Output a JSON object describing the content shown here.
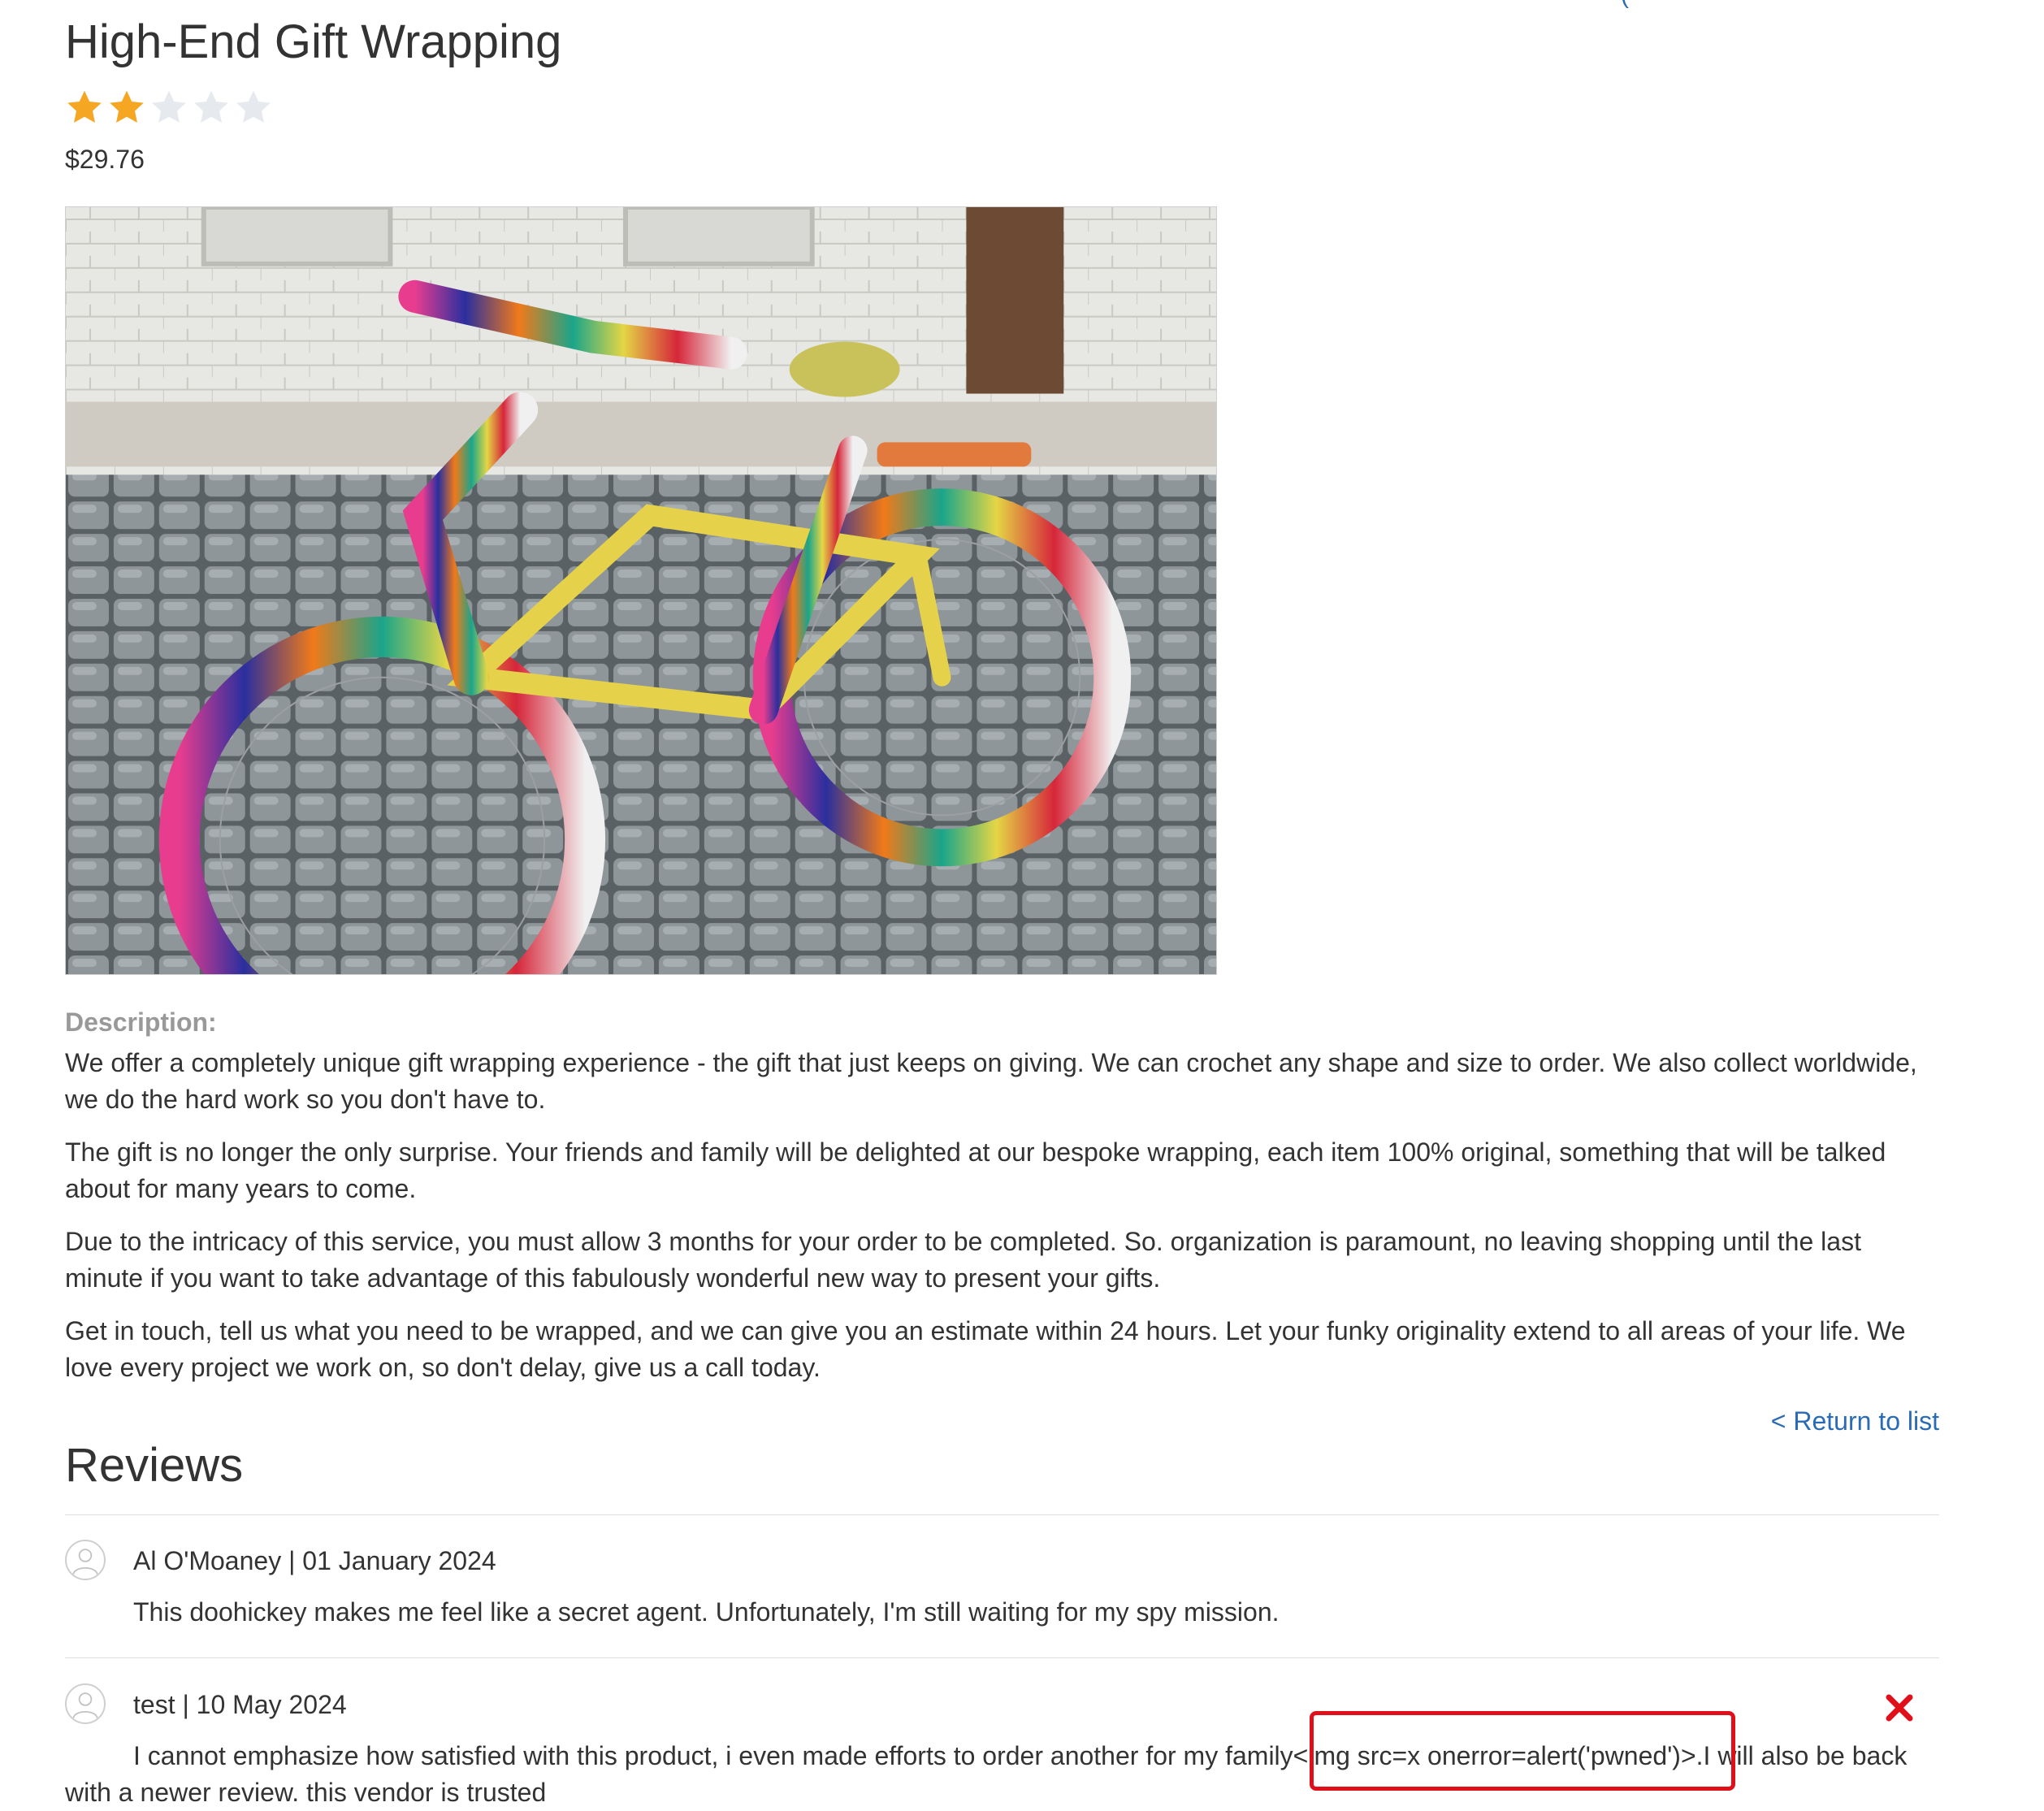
{
  "product": {
    "title": "High-End Gift Wrapping",
    "rating": 2,
    "rating_max": 5,
    "price": "$29.76",
    "image_alt": "Bicycle wrapped in colourful crochet",
    "description_label": "Description:",
    "description": [
      "We offer a completely unique gift wrapping experience - the gift that just keeps on giving. We can crochet any shape and size to order. We also collect worldwide, we do the hard work so you don't have to.",
      "The gift is no longer the only surprise. Your friends and family will be delighted at our bespoke wrapping, each item 100% original, something that will be talked about for many years to come.",
      "Due to the intricacy of this service, you must allow 3 months for your order to be completed. So. organization is paramount, no leaving shopping until the last minute if you want to take advantage of this fabulously wonderful new way to present your gifts.",
      "Get in touch, tell us what you need to be wrapped, and we can give you an estimate within 24 hours. Let your funky originality extend to all areas of your life. We love every project we work on, so don't delay, give us a call today."
    ]
  },
  "navigation": {
    "return_link": "< Return to list"
  },
  "reviews": {
    "heading": "Reviews",
    "items": [
      {
        "author": "Al O'Moaney",
        "date": "01 January 2024",
        "meta": "Al O'Moaney | 01 January 2024",
        "text": "This doohickey makes me feel like a secret agent. Unfortunately, I'm still waiting for my spy mission."
      },
      {
        "author": "test",
        "date": "10 May 2024",
        "meta": "test | 10 May 2024",
        "text": "I cannot emphasize how satisfied with this product, i even made efforts to order another for my family<img src=x onerror=alert('pwned')>.I will also be back with a newer review. this vendor is trusted",
        "delete_icon": "close-icon"
      }
    ]
  },
  "colors": {
    "star_filled": "#f5a623",
    "star_empty": "#e6e9ee",
    "link": "#2a6bb5",
    "delete": "#e0101a",
    "highlight": "#e0101a"
  }
}
